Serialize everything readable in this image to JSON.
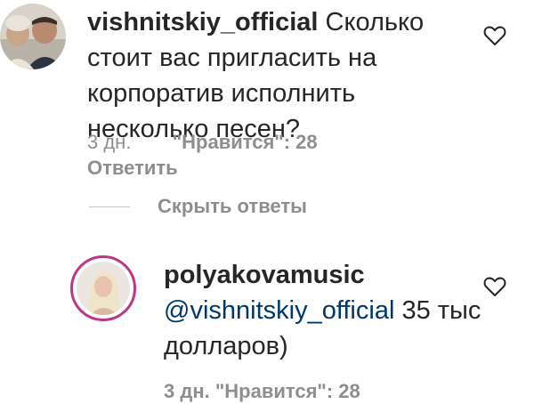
{
  "comments": [
    {
      "username": "vishnitskiy_official",
      "text": " Сколько стоит вас пригласить на корпоратив исполнить несколько песен?",
      "time": "3 дн.",
      "likes": "\"Нравится\": 28",
      "reply_label": "Ответить"
    },
    {
      "username": "polyakovamusic",
      "mention": "@vishnitskiy_official",
      "text": " 35 тыс долларов)",
      "cut_meta": "3 дн.   \"Нравится\": 28"
    }
  ],
  "hide_replies_label": "Скрыть ответы",
  "colors": {
    "text": "#262626",
    "secondary": "#8e8e8e",
    "mention": "#00376b",
    "story_ring": "#c13584"
  },
  "icons": {
    "like": "heart-outline-icon"
  }
}
